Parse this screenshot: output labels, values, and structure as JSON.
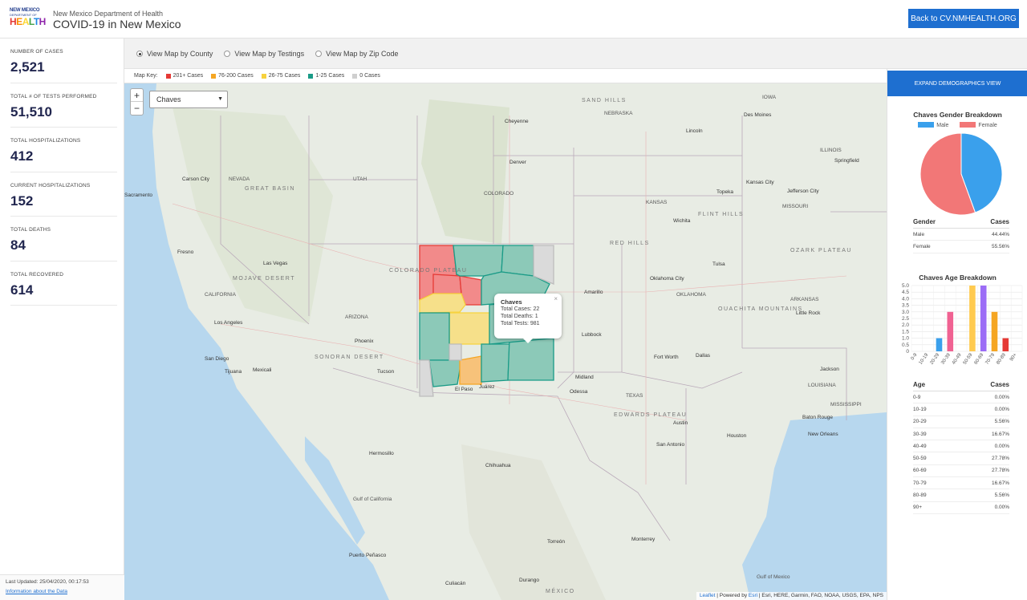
{
  "header": {
    "logo_line1": "NEW MEXICO",
    "logo_line2": "DEPARTMENT OF",
    "logo_line3": [
      "H",
      "E",
      "A",
      "L",
      "T",
      "H"
    ],
    "department": "New Mexico Department of Health",
    "title": "COVID-19 in New Mexico",
    "back_button": "Back to CV.NMHEALTH.ORG"
  },
  "stats": [
    {
      "label": "NUMBER OF CASES",
      "value": "2,521"
    },
    {
      "label": "TOTAL # OF TESTS PERFORMED",
      "value": "51,510"
    },
    {
      "label": "TOTAL HOSPITALIZATIONS",
      "value": "412"
    },
    {
      "label": "CURRENT HOSPITALIZATIONS",
      "value": "152"
    },
    {
      "label": "TOTAL DEATHS",
      "value": "84"
    },
    {
      "label": "TOTAL RECOVERED",
      "value": "614"
    }
  ],
  "footer": {
    "last_updated": "Last Updated: 25/04/2020, 00:17:53",
    "info_link": "Information about the Data"
  },
  "view_options": [
    {
      "label": "View Map by County",
      "selected": true
    },
    {
      "label": "View Map by Testings",
      "selected": false
    },
    {
      "label": "View Map by Zip Code",
      "selected": false
    }
  ],
  "map_key": {
    "title": "Map Key:",
    "items": [
      {
        "label": "201+ Cases",
        "color": "#e53935"
      },
      {
        "label": "76-200 Cases",
        "color": "#f5a623"
      },
      {
        "label": "26-75 Cases",
        "color": "#f7d23e"
      },
      {
        "label": "1-25 Cases",
        "color": "#1a9b87"
      },
      {
        "label": "0 Cases",
        "color": "#cfcfcf"
      }
    ]
  },
  "map": {
    "zoom_in": "+",
    "zoom_out": "−",
    "selected_county": "Chaves",
    "popup": {
      "title": "Chaves",
      "close": "×",
      "lines": [
        "Total Cases: 22",
        "Total Deaths: 1",
        "Total Tests: 981"
      ]
    },
    "attribution_leaflet": "Leaflet",
    "attribution_rest": " | Powered by ",
    "attribution_esri": "Esri",
    "attribution_tail": " | Esri, HERE, Garmin, FAO, NOAA, USGS, EPA, NPS",
    "labels": [
      {
        "text": "SAND HILLS",
        "big": true
      },
      {
        "text": "NEBRASKA"
      },
      {
        "text": "IOWA"
      },
      {
        "text": "Des Moines",
        "city": true
      },
      {
        "text": "Lincoln",
        "city": true
      },
      {
        "text": "Cheyenne",
        "city": true
      },
      {
        "text": "Denver",
        "city": true
      },
      {
        "text": "COLORADO"
      },
      {
        "text": "KANSAS"
      },
      {
        "text": "Topeka",
        "city": true
      },
      {
        "text": "Kansas City",
        "city": true
      },
      {
        "text": "MISSOURI"
      },
      {
        "text": "ILLINOIS"
      },
      {
        "text": "Springfield",
        "city": true
      },
      {
        "text": "Jefferson City",
        "city": true
      },
      {
        "text": "Wichita",
        "city": true
      },
      {
        "text": "FLINT HILLS",
        "big": true
      },
      {
        "text": "RED HILLS",
        "big": true
      },
      {
        "text": "OZARK PLATEAU",
        "big": true
      },
      {
        "text": "Tulsa",
        "city": true
      },
      {
        "text": "Oklahoma City",
        "city": true
      },
      {
        "text": "OKLAHOMA"
      },
      {
        "text": "ARKANSAS"
      },
      {
        "text": "Little Rock",
        "city": true
      },
      {
        "text": "OUACHITA MOUNTAINS",
        "big": true
      },
      {
        "text": "Amarillo",
        "city": true
      },
      {
        "text": "Lubbock",
        "city": true
      },
      {
        "text": "Fort Worth",
        "city": true
      },
      {
        "text": "Dallas",
        "city": true
      },
      {
        "text": "Midland",
        "city": true
      },
      {
        "text": "Odessa",
        "city": true
      },
      {
        "text": "TEXAS"
      },
      {
        "text": "EDWARDS PLATEAU",
        "big": true
      },
      {
        "text": "Austin",
        "city": true
      },
      {
        "text": "Houston",
        "city": true
      },
      {
        "text": "San Antonio",
        "city": true
      },
      {
        "text": "LOUISIANA"
      },
      {
        "text": "Baton Rouge",
        "city": true
      },
      {
        "text": "New Orleans",
        "city": true
      },
      {
        "text": "Jackson",
        "city": true
      },
      {
        "text": "MISSISSIPPI"
      },
      {
        "text": "Carson City",
        "city": true
      },
      {
        "text": "NEVADA"
      },
      {
        "text": "GREAT BASIN",
        "big": true
      },
      {
        "text": "Sacramento",
        "city": true
      },
      {
        "text": "Fresno",
        "city": true
      },
      {
        "text": "CALIFORNIA"
      },
      {
        "text": "MOJAVE DESERT",
        "big": true
      },
      {
        "text": "Las Vegas",
        "city": true
      },
      {
        "text": "COLORADO PLATEAU",
        "big": true
      },
      {
        "text": "Los Angeles",
        "city": true
      },
      {
        "text": "San Diego",
        "city": true
      },
      {
        "text": "Tijuana",
        "city": true
      },
      {
        "text": "Mexicali",
        "city": true
      },
      {
        "text": "Phoenix",
        "city": true
      },
      {
        "text": "Tucson",
        "city": true
      },
      {
        "text": "ARIZONA"
      },
      {
        "text": "SONORAN DESERT",
        "big": true
      },
      {
        "text": "UTAH"
      },
      {
        "text": "El Paso",
        "city": true
      },
      {
        "text": "Juárez",
        "city": true
      },
      {
        "text": "Hermosillo",
        "city": true
      },
      {
        "text": "Chihuahua",
        "city": true
      },
      {
        "text": "Torreón",
        "city": true
      },
      {
        "text": "Monterrey",
        "city": true
      },
      {
        "text": "Culiacán",
        "city": true
      },
      {
        "text": "Durango",
        "city": true
      },
      {
        "text": "Puerto Peñasco",
        "city": true
      },
      {
        "text": "Gulf of California"
      },
      {
        "text": "Gulf of Mexico"
      },
      {
        "text": "MÉXICO",
        "big": true
      }
    ]
  },
  "right_panel": {
    "expand_button": "EXPAND DEMOGRAPHICS VIEW",
    "gender_title": "Chaves Gender Breakdown",
    "age_title": "Chaves Age Breakdown",
    "gender_header": {
      "left": "Gender",
      "right": "Cases"
    },
    "age_header": {
      "left": "Age",
      "right": "Cases"
    },
    "gender_rows": [
      {
        "label": "Male",
        "value": "44.44%"
      },
      {
        "label": "Female",
        "value": "55.56%"
      }
    ],
    "age_rows": [
      {
        "label": "0-9",
        "value": "0.00%"
      },
      {
        "label": "10-19",
        "value": "0.00%"
      },
      {
        "label": "20-29",
        "value": "5.56%"
      },
      {
        "label": "30-39",
        "value": "16.67%"
      },
      {
        "label": "40-49",
        "value": "0.00%"
      },
      {
        "label": "50-59",
        "value": "27.78%"
      },
      {
        "label": "60-69",
        "value": "27.78%"
      },
      {
        "label": "70-79",
        "value": "16.67%"
      },
      {
        "label": "80-89",
        "value": "5.56%"
      },
      {
        "label": "90+",
        "value": "0.00%"
      }
    ]
  },
  "chart_data": [
    {
      "type": "pie",
      "title": "Chaves Gender Breakdown",
      "categories": [
        "Male",
        "Female"
      ],
      "values": [
        44.44,
        55.56
      ],
      "colors": [
        "#3aa0ec",
        "#f27777"
      ],
      "legend": "top"
    },
    {
      "type": "bar",
      "title": "Chaves Age Breakdown",
      "categories": [
        "0-9",
        "10-19",
        "20-29",
        "30-39",
        "40-49",
        "50-59",
        "60-69",
        "70-79",
        "80-89",
        "90+"
      ],
      "values": [
        0,
        0,
        1,
        3,
        0,
        5,
        5,
        3,
        1,
        0
      ],
      "colors": [
        "#e53935",
        "#fb8c00",
        "#3aa0ec",
        "#f06292",
        "#9ccc65",
        "#ffca4f",
        "#9b6cf6",
        "#f5a623",
        "#e53935",
        "#2e7d32"
      ],
      "yticks": [
        "0",
        "0.5",
        "1.0",
        "1.5",
        "2.0",
        "2.5",
        "3.0",
        "3.5",
        "4.0",
        "4.5",
        "5.0"
      ],
      "ylim": [
        0,
        5
      ],
      "xlabel": "",
      "ylabel": "",
      "grid": true
    }
  ]
}
